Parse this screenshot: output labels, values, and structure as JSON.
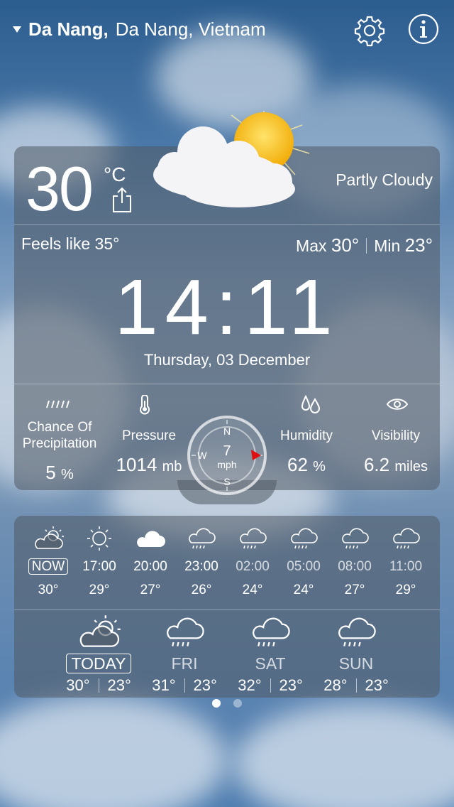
{
  "location": {
    "city": "Da Nang,",
    "rest": "Da Nang, Vietnam"
  },
  "icons": {
    "settings": "gear-icon",
    "info": "info-icon",
    "share": "share-icon",
    "dropdown": "triangle-down-icon"
  },
  "current": {
    "temperature": "30",
    "unit": "°C",
    "condition": "Partly Cloudy",
    "feels_like": "Feels like 35°",
    "max_label": "Max",
    "max_value": "30°",
    "min_label": "Min",
    "min_value": "23°",
    "time": "14:11",
    "date": "Thursday, 03 December"
  },
  "stats": {
    "precip_label_1": "Chance Of",
    "precip_label_2": "Precipitation",
    "precip_value": "5",
    "precip_unit": "%",
    "pressure_label": "Pressure",
    "pressure_value": "1014",
    "pressure_unit": "mb",
    "humidity_label": "Humidity",
    "humidity_value": "62",
    "humidity_unit": "%",
    "visibility_label": "Visibility",
    "visibility_value": "6.2",
    "visibility_unit": "miles"
  },
  "wind": {
    "speed": "7",
    "unit": "mph",
    "n": "N",
    "s": "S",
    "w": "W"
  },
  "hourly": [
    {
      "time": "NOW",
      "temp": "30°",
      "icon": "partly-cloudy-icon"
    },
    {
      "time": "17:00",
      "temp": "29°",
      "icon": "sun-icon"
    },
    {
      "time": "20:00",
      "temp": "27°",
      "icon": "cloud-icon"
    },
    {
      "time": "23:00",
      "temp": "26°",
      "icon": "rain-cloud-icon"
    },
    {
      "time": "02:00",
      "temp": "24°",
      "icon": "rain-cloud-icon"
    },
    {
      "time": "05:00",
      "temp": "24°",
      "icon": "rain-cloud-icon"
    },
    {
      "time": "08:00",
      "temp": "27°",
      "icon": "rain-cloud-icon"
    },
    {
      "time": "11:00",
      "temp": "29°",
      "icon": "rain-cloud-icon"
    }
  ],
  "daily": [
    {
      "day": "TODAY",
      "max": "30°",
      "min": "23°",
      "icon": "partly-cloudy-icon"
    },
    {
      "day": "FRI",
      "max": "31°",
      "min": "23°",
      "icon": "rain-cloud-icon"
    },
    {
      "day": "SAT",
      "max": "32°",
      "min": "23°",
      "icon": "rain-cloud-icon"
    },
    {
      "day": "SUN",
      "max": "28°",
      "min": "23°",
      "icon": "rain-cloud-icon"
    }
  ],
  "pager": {
    "pages": 2,
    "current": 1
  }
}
